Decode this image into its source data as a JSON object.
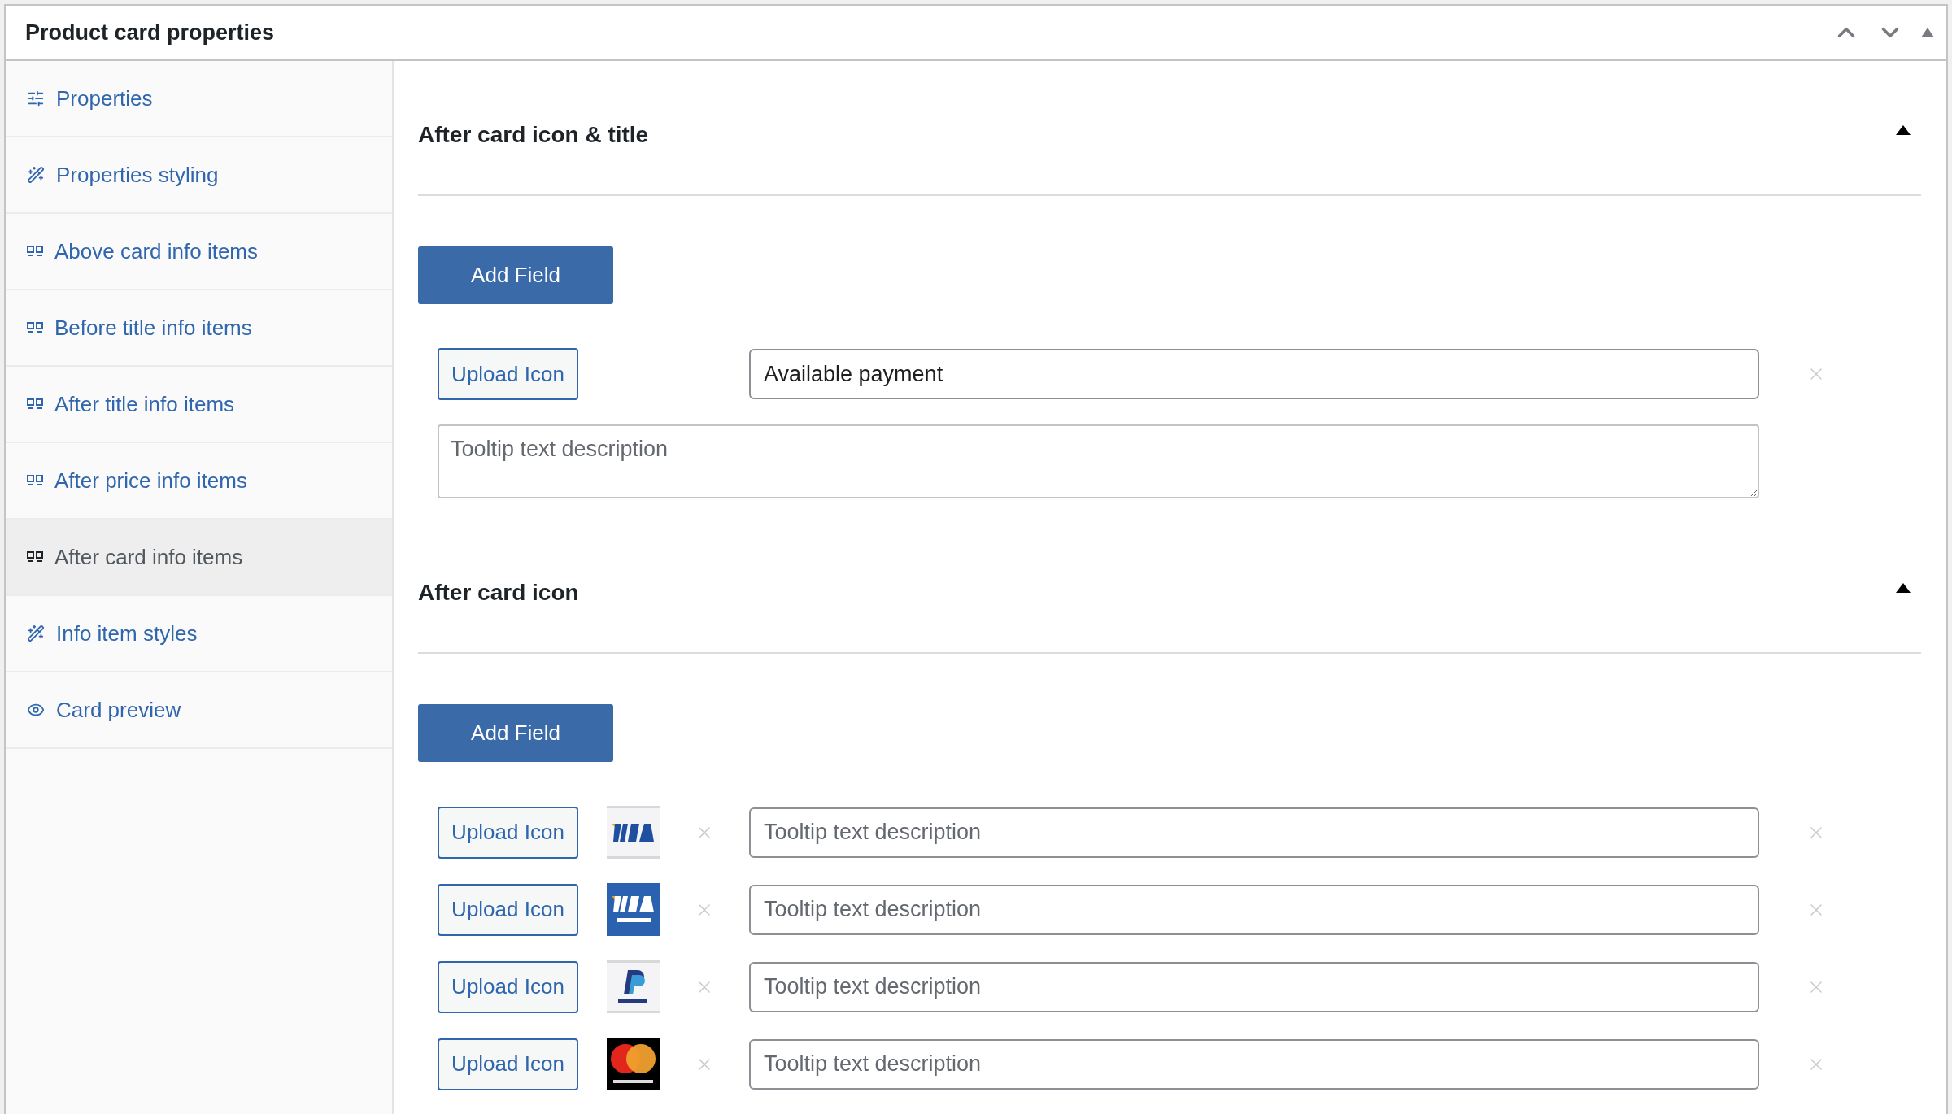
{
  "panel": {
    "title": "Product card properties"
  },
  "sidebar": {
    "items": [
      {
        "label": "Properties",
        "selected": false
      },
      {
        "label": "Properties styling",
        "selected": false
      },
      {
        "label": "Above card info items",
        "selected": false
      },
      {
        "label": "Before title info items",
        "selected": false
      },
      {
        "label": "After title info items",
        "selected": false
      },
      {
        "label": "After price info items",
        "selected": false
      },
      {
        "label": "After card info items",
        "selected": true
      },
      {
        "label": "Info item styles",
        "selected": false
      },
      {
        "label": "Card preview",
        "selected": false
      }
    ]
  },
  "sections": [
    {
      "title": "After card icon & title",
      "expanded": true,
      "add_button": "Add Field",
      "fields": [
        {
          "kind": "titled",
          "upload_button": "Upload Icon",
          "title_value": "Available payment",
          "tooltip_placeholder": "Tooltip text description"
        }
      ]
    },
    {
      "title": "After card icon",
      "expanded": true,
      "add_button": "Add Field",
      "fields": [
        {
          "kind": "icon",
          "upload_button": "Upload Icon",
          "tooltip_placeholder": "Tooltip text description"
        },
        {
          "kind": "icon",
          "upload_button": "Upload Icon",
          "tooltip_placeholder": "Tooltip text description"
        },
        {
          "kind": "icon",
          "upload_button": "Upload Icon",
          "tooltip_placeholder": "Tooltip text description"
        },
        {
          "kind": "icon",
          "upload_button": "Upload Icon",
          "tooltip_placeholder": "Tooltip text description"
        }
      ]
    }
  ]
}
